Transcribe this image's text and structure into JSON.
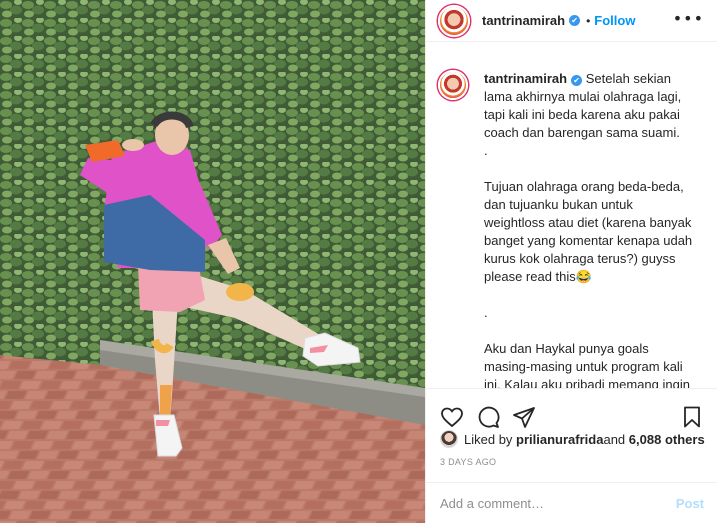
{
  "post": {
    "username": "tantrinamirah",
    "verified_symbol": "✔",
    "separator": "•",
    "follow_label": "Follow",
    "more_label": "•••",
    "caption_username": "tantrinamirah",
    "caption_text": "Setelah sekian lama akhirnya mulai olahraga lagi, tapi kali ini beda karena aku pakai coach dan barengan sama suami.\n.\n\nTujuan olahraga orang beda-beda, dan tujuanku bukan untuk weightloss atau diet (karena banyak banget yang komentar kenapa udah kurus kok olahraga terus?) guyss please read this😂\n\n.\n\nAku dan Haykal punya goals masing-masing untuk program kali ini. Kalau aku pribadi memang ingin meningkatkan strength tubuhku,",
    "likes_prefix": "Liked by ",
    "likes_user": "prilianurafrida",
    "likes_and": " and ",
    "likes_count": "6,088 others",
    "date": "3 DAYS AGO",
    "comment_placeholder": "Add a comment…",
    "post_label": "Post"
  },
  "icons": [
    "heart-icon",
    "comment-icon",
    "share-icon",
    "bookmark-icon"
  ],
  "colors": {
    "accent": "#0095f6",
    "post_disabled": "#b2dffc",
    "muted": "#8e8e8e",
    "verified": "#3897f0"
  }
}
